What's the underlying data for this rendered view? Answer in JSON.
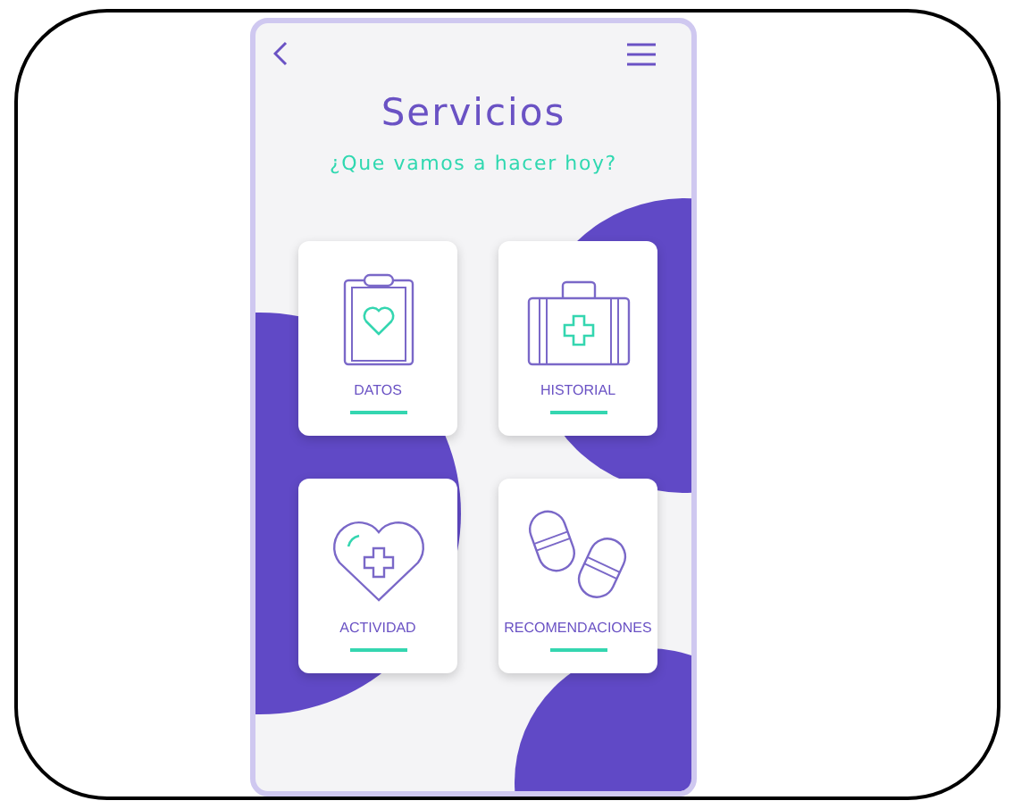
{
  "screen": {
    "title": "Servicios",
    "subtitle": "¿Que vamos a hacer hoy?"
  },
  "services": [
    {
      "label": "DATOS",
      "kind": "clipboard"
    },
    {
      "label": "HISTORIAL",
      "kind": "briefcase"
    },
    {
      "label": "ACTIVIDAD",
      "kind": "heart"
    },
    {
      "label": "RECOMENDACIONES",
      "kind": "pills"
    }
  ]
}
